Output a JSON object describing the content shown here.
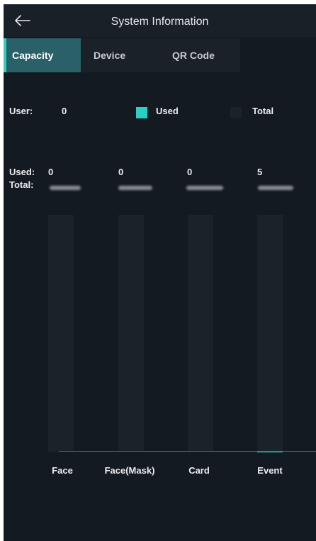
{
  "header": {
    "title": "System Information",
    "back_icon": "back-arrow-icon"
  },
  "tabs": [
    {
      "label": "Capacity",
      "active": true
    },
    {
      "label": "Device",
      "active": false
    },
    {
      "label": "QR Code",
      "active": false
    }
  ],
  "user_row": {
    "label": "User:",
    "value": "0"
  },
  "legend": {
    "used_label": "Used",
    "total_label": "Total",
    "used_color": "#2ad0c2",
    "total_color": "#1c2229"
  },
  "stats": {
    "used_label": "Used:",
    "total_label": "Total:"
  },
  "chart_data": {
    "type": "bar",
    "categories": [
      "Face",
      "Face(Mask)",
      "Card",
      "Event"
    ],
    "series": [
      {
        "name": "Used",
        "values": [
          0,
          0,
          0,
          5
        ]
      }
    ],
    "used_text": [
      "0",
      "0",
      "0",
      "5"
    ],
    "total_text": "obscured (blurred)"
  }
}
